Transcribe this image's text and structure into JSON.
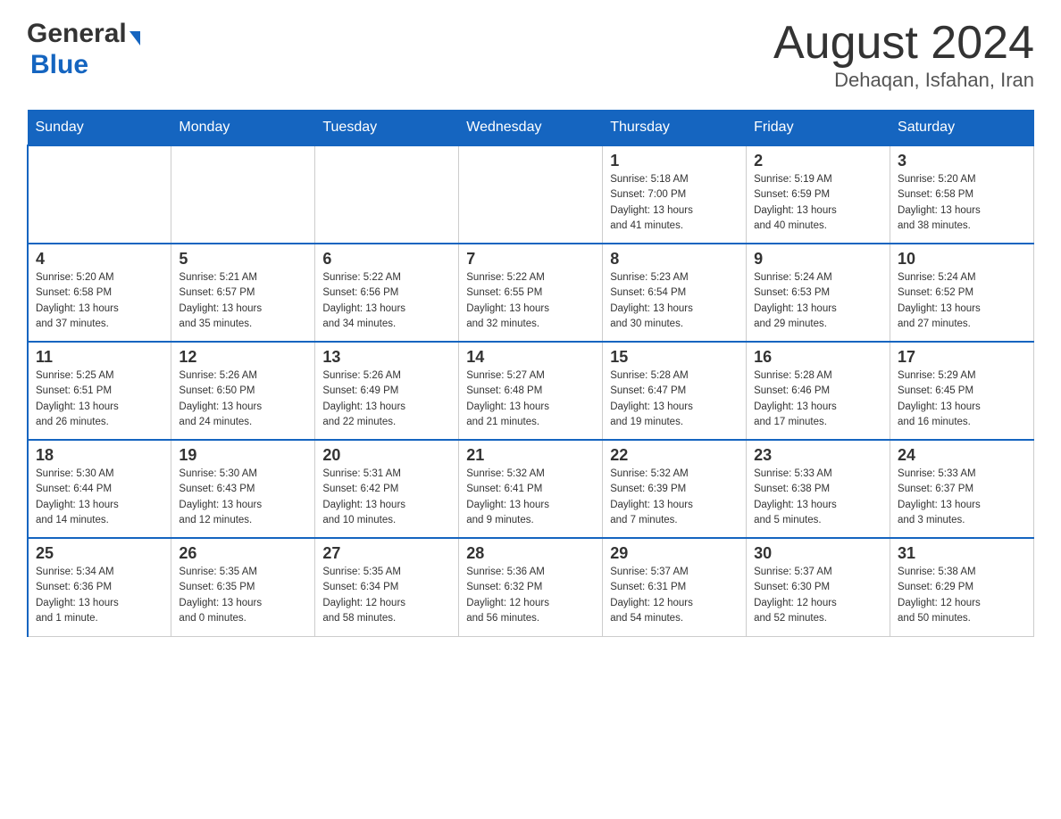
{
  "header": {
    "logo_general": "General",
    "logo_blue": "Blue",
    "month": "August 2024",
    "location": "Dehaqan, Isfahan, Iran"
  },
  "days_of_week": [
    "Sunday",
    "Monday",
    "Tuesday",
    "Wednesday",
    "Thursday",
    "Friday",
    "Saturday"
  ],
  "weeks": [
    [
      {
        "day": "",
        "info": ""
      },
      {
        "day": "",
        "info": ""
      },
      {
        "day": "",
        "info": ""
      },
      {
        "day": "",
        "info": ""
      },
      {
        "day": "1",
        "info": "Sunrise: 5:18 AM\nSunset: 7:00 PM\nDaylight: 13 hours\nand 41 minutes."
      },
      {
        "day": "2",
        "info": "Sunrise: 5:19 AM\nSunset: 6:59 PM\nDaylight: 13 hours\nand 40 minutes."
      },
      {
        "day": "3",
        "info": "Sunrise: 5:20 AM\nSunset: 6:58 PM\nDaylight: 13 hours\nand 38 minutes."
      }
    ],
    [
      {
        "day": "4",
        "info": "Sunrise: 5:20 AM\nSunset: 6:58 PM\nDaylight: 13 hours\nand 37 minutes."
      },
      {
        "day": "5",
        "info": "Sunrise: 5:21 AM\nSunset: 6:57 PM\nDaylight: 13 hours\nand 35 minutes."
      },
      {
        "day": "6",
        "info": "Sunrise: 5:22 AM\nSunset: 6:56 PM\nDaylight: 13 hours\nand 34 minutes."
      },
      {
        "day": "7",
        "info": "Sunrise: 5:22 AM\nSunset: 6:55 PM\nDaylight: 13 hours\nand 32 minutes."
      },
      {
        "day": "8",
        "info": "Sunrise: 5:23 AM\nSunset: 6:54 PM\nDaylight: 13 hours\nand 30 minutes."
      },
      {
        "day": "9",
        "info": "Sunrise: 5:24 AM\nSunset: 6:53 PM\nDaylight: 13 hours\nand 29 minutes."
      },
      {
        "day": "10",
        "info": "Sunrise: 5:24 AM\nSunset: 6:52 PM\nDaylight: 13 hours\nand 27 minutes."
      }
    ],
    [
      {
        "day": "11",
        "info": "Sunrise: 5:25 AM\nSunset: 6:51 PM\nDaylight: 13 hours\nand 26 minutes."
      },
      {
        "day": "12",
        "info": "Sunrise: 5:26 AM\nSunset: 6:50 PM\nDaylight: 13 hours\nand 24 minutes."
      },
      {
        "day": "13",
        "info": "Sunrise: 5:26 AM\nSunset: 6:49 PM\nDaylight: 13 hours\nand 22 minutes."
      },
      {
        "day": "14",
        "info": "Sunrise: 5:27 AM\nSunset: 6:48 PM\nDaylight: 13 hours\nand 21 minutes."
      },
      {
        "day": "15",
        "info": "Sunrise: 5:28 AM\nSunset: 6:47 PM\nDaylight: 13 hours\nand 19 minutes."
      },
      {
        "day": "16",
        "info": "Sunrise: 5:28 AM\nSunset: 6:46 PM\nDaylight: 13 hours\nand 17 minutes."
      },
      {
        "day": "17",
        "info": "Sunrise: 5:29 AM\nSunset: 6:45 PM\nDaylight: 13 hours\nand 16 minutes."
      }
    ],
    [
      {
        "day": "18",
        "info": "Sunrise: 5:30 AM\nSunset: 6:44 PM\nDaylight: 13 hours\nand 14 minutes."
      },
      {
        "day": "19",
        "info": "Sunrise: 5:30 AM\nSunset: 6:43 PM\nDaylight: 13 hours\nand 12 minutes."
      },
      {
        "day": "20",
        "info": "Sunrise: 5:31 AM\nSunset: 6:42 PM\nDaylight: 13 hours\nand 10 minutes."
      },
      {
        "day": "21",
        "info": "Sunrise: 5:32 AM\nSunset: 6:41 PM\nDaylight: 13 hours\nand 9 minutes."
      },
      {
        "day": "22",
        "info": "Sunrise: 5:32 AM\nSunset: 6:39 PM\nDaylight: 13 hours\nand 7 minutes."
      },
      {
        "day": "23",
        "info": "Sunrise: 5:33 AM\nSunset: 6:38 PM\nDaylight: 13 hours\nand 5 minutes."
      },
      {
        "day": "24",
        "info": "Sunrise: 5:33 AM\nSunset: 6:37 PM\nDaylight: 13 hours\nand 3 minutes."
      }
    ],
    [
      {
        "day": "25",
        "info": "Sunrise: 5:34 AM\nSunset: 6:36 PM\nDaylight: 13 hours\nand 1 minute."
      },
      {
        "day": "26",
        "info": "Sunrise: 5:35 AM\nSunset: 6:35 PM\nDaylight: 13 hours\nand 0 minutes."
      },
      {
        "day": "27",
        "info": "Sunrise: 5:35 AM\nSunset: 6:34 PM\nDaylight: 12 hours\nand 58 minutes."
      },
      {
        "day": "28",
        "info": "Sunrise: 5:36 AM\nSunset: 6:32 PM\nDaylight: 12 hours\nand 56 minutes."
      },
      {
        "day": "29",
        "info": "Sunrise: 5:37 AM\nSunset: 6:31 PM\nDaylight: 12 hours\nand 54 minutes."
      },
      {
        "day": "30",
        "info": "Sunrise: 5:37 AM\nSunset: 6:30 PM\nDaylight: 12 hours\nand 52 minutes."
      },
      {
        "day": "31",
        "info": "Sunrise: 5:38 AM\nSunset: 6:29 PM\nDaylight: 12 hours\nand 50 minutes."
      }
    ]
  ]
}
